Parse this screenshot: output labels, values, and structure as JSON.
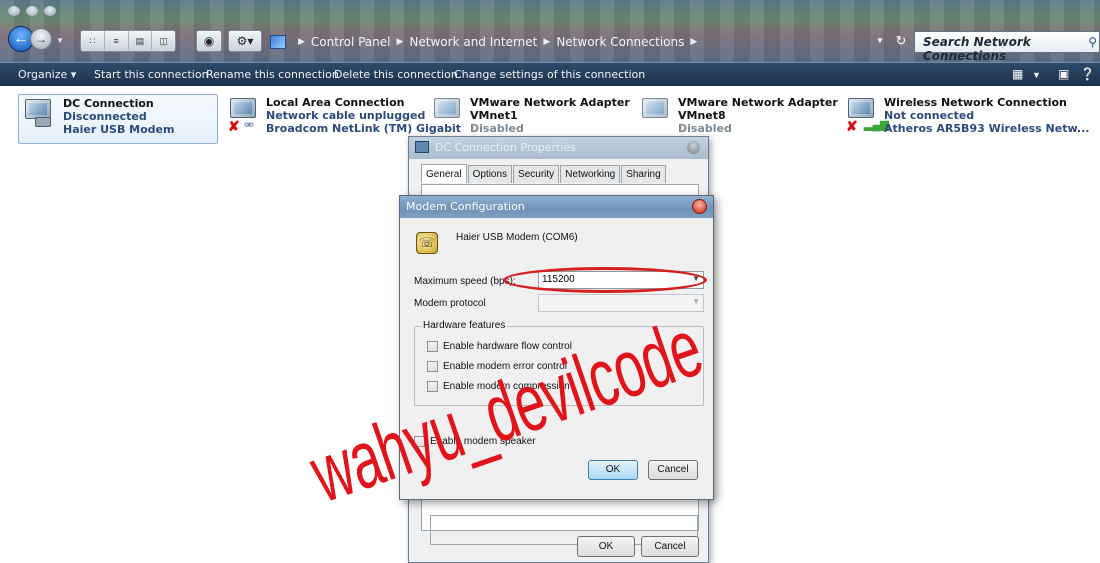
{
  "address": {
    "crumbs": [
      "Control Panel",
      "Network and Internet",
      "Network Connections"
    ],
    "search_placeholder": "Search Network Connections"
  },
  "toolbar": {
    "organize": "Organize ▾",
    "start": "Start this connection",
    "rename": "Rename this connection",
    "delete": "Delete this connection",
    "change": "Change settings of this connection"
  },
  "connections": [
    {
      "name": "DC Connection",
      "status": "Disconnected",
      "device": "Haier USB Modem"
    },
    {
      "name": "Local Area Connection",
      "status": "Network cable unplugged",
      "device": "Broadcom NetLink (TM) Gigabit"
    },
    {
      "name": "VMware Network Adapter VMnet1",
      "name_line1": "VMware Network Adapter",
      "name_line2": "VMnet1",
      "status": "Disabled"
    },
    {
      "name": "VMware Network Adapter VMnet8",
      "name_line1": "VMware Network Adapter",
      "name_line2": "VMnet8",
      "status": "Disabled"
    },
    {
      "name": "Wireless Network Connection",
      "status": "Not connected",
      "device": "Atheros AR5B93 Wireless Netw..."
    }
  ],
  "properties_dialog": {
    "title": "DC Connection Properties",
    "tabs": [
      "General",
      "Options",
      "Security",
      "Networking",
      "Sharing"
    ],
    "active_tab": "General",
    "ok": "OK",
    "cancel": "Cancel"
  },
  "modem_dialog": {
    "title": "Modem Configuration",
    "device": "Haier USB Modem (COM6)",
    "max_speed_label": "Maximum speed (bps):",
    "max_speed_value": "115200",
    "protocol_label": "Modem protocol",
    "protocol_value": "",
    "hardware_group": "Hardware features",
    "hw_flow": "Enable hardware flow control",
    "error_control": "Enable modem error control",
    "compression": "Enable modem compression",
    "speaker": "Enable modem speaker",
    "ok": "OK",
    "cancel": "Cancel"
  },
  "watermark": "wahyu_devilcode",
  "colors": {
    "watermark": "#e0141b",
    "command_bar": "#1b3149",
    "link_blue": "#2c4b7a",
    "highlight_circle": "#d41f1f"
  }
}
